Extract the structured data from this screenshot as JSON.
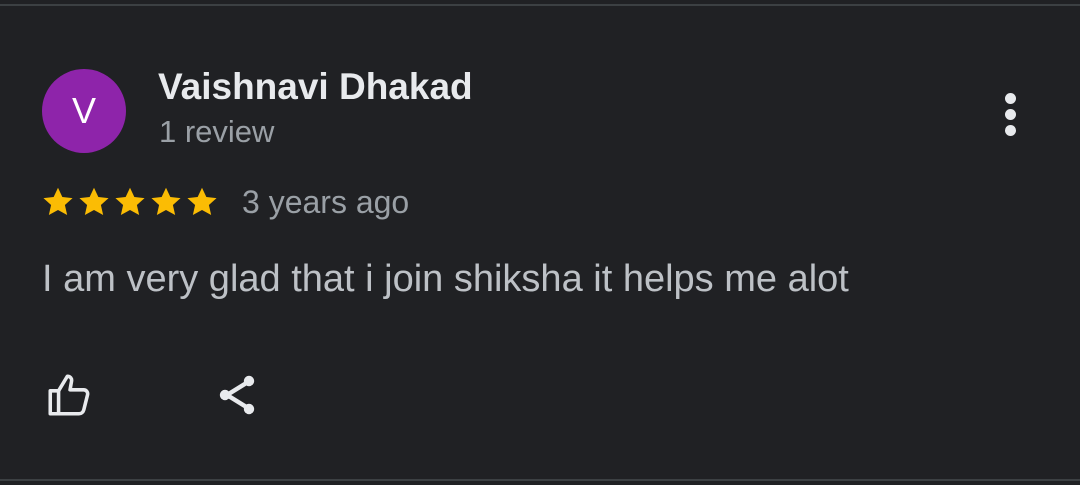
{
  "review": {
    "avatar_initial": "V",
    "avatar_color": "#8e24aa",
    "author_name": "Vaishnavi Dhakad",
    "review_count": "1 review",
    "rating": 5,
    "rating_max": 5,
    "star_color": "#fbbc04",
    "timestamp": "3 years ago",
    "text": "I am very glad that i join shiksha it helps me alot"
  },
  "icons": {
    "more": "more-vertical-icon",
    "like": "thumbs-up-icon",
    "share": "share-icon",
    "star": "star-icon"
  }
}
